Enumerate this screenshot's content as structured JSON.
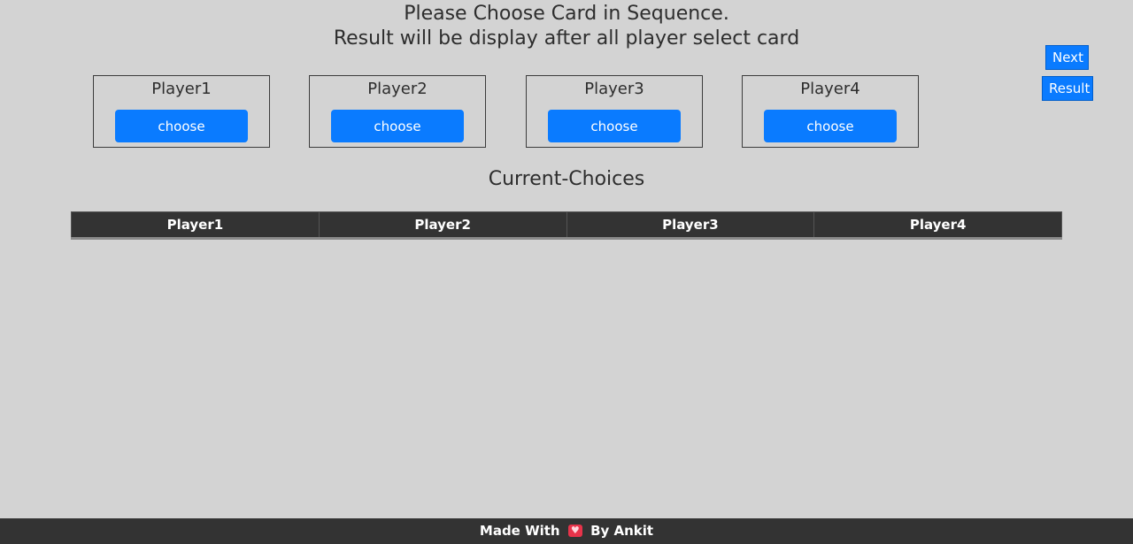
{
  "header": {
    "line1": "Please Choose Card in Sequence.",
    "line2": "Result will be display after all player select card"
  },
  "controls": {
    "next_label": "Next",
    "result_label": "Result"
  },
  "players": [
    {
      "name": "Player1",
      "button_label": "choose"
    },
    {
      "name": "Player2",
      "button_label": "choose"
    },
    {
      "name": "Player3",
      "button_label": "choose"
    },
    {
      "name": "Player4",
      "button_label": "choose"
    }
  ],
  "current_choices": {
    "title": "Current-Choices",
    "columns": [
      "Player1",
      "Player2",
      "Player3",
      "Player4"
    ],
    "rows": []
  },
  "footer": {
    "prefix": "Made With",
    "icon": "heart-icon",
    "suffix": "By Ankit"
  },
  "colors": {
    "background": "#d3d3d3",
    "primary_button": "#0a7bff",
    "dark_bar": "#333333"
  }
}
